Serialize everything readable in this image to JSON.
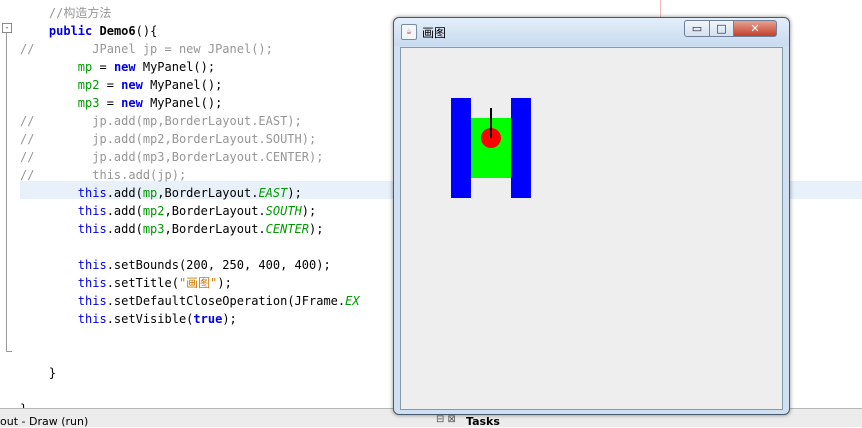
{
  "editor": {
    "lines": [
      {
        "parts": [
          {
            "t": "    ",
            "c": ""
          },
          {
            "t": "//构造方法",
            "c": "cm"
          }
        ]
      },
      {
        "parts": [
          {
            "t": "    ",
            "c": ""
          },
          {
            "t": "public",
            "c": "kwb"
          },
          {
            "t": " ",
            "c": ""
          },
          {
            "t": "Demo6",
            "c": "mth"
          },
          {
            "t": "(){",
            "c": ""
          }
        ]
      },
      {
        "parts": [
          {
            "t": "//        JPanel jp = new JPanel();",
            "c": "cm"
          }
        ]
      },
      {
        "parts": [
          {
            "t": "        ",
            "c": ""
          },
          {
            "t": "mp",
            "c": "fld"
          },
          {
            "t": " = ",
            "c": ""
          },
          {
            "t": "new",
            "c": "kwb"
          },
          {
            "t": " MyPanel();",
            "c": ""
          }
        ]
      },
      {
        "parts": [
          {
            "t": "        ",
            "c": ""
          },
          {
            "t": "mp2",
            "c": "fld"
          },
          {
            "t": " = ",
            "c": ""
          },
          {
            "t": "new",
            "c": "kwb"
          },
          {
            "t": " MyPanel();",
            "c": ""
          }
        ]
      },
      {
        "parts": [
          {
            "t": "        ",
            "c": ""
          },
          {
            "t": "mp3",
            "c": "fld"
          },
          {
            "t": " = ",
            "c": ""
          },
          {
            "t": "new",
            "c": "kwb"
          },
          {
            "t": " MyPanel();",
            "c": ""
          }
        ]
      },
      {
        "parts": [
          {
            "t": "//        jp.add(mp,BorderLayout.EAST);",
            "c": "cm"
          }
        ]
      },
      {
        "parts": [
          {
            "t": "//        jp.add(mp2,BorderLayout.SOUTH);",
            "c": "cm"
          }
        ]
      },
      {
        "parts": [
          {
            "t": "//        jp.add(mp3,BorderLayout.CENTER);",
            "c": "cm"
          }
        ]
      },
      {
        "parts": [
          {
            "t": "//        this.add(jp);",
            "c": "cm"
          }
        ]
      },
      {
        "parts": [
          {
            "t": "        ",
            "c": ""
          },
          {
            "t": "this",
            "c": "kw"
          },
          {
            "t": ".add(",
            "c": ""
          },
          {
            "t": "mp",
            "c": "fld"
          },
          {
            "t": ",BorderLayout.",
            "c": ""
          },
          {
            "t": "EAST",
            "c": "sfld"
          },
          {
            "t": ");",
            "c": ""
          }
        ]
      },
      {
        "parts": [
          {
            "t": "        ",
            "c": ""
          },
          {
            "t": "this",
            "c": "kw"
          },
          {
            "t": ".add(",
            "c": ""
          },
          {
            "t": "mp2",
            "c": "fld"
          },
          {
            "t": ",BorderLayout.",
            "c": ""
          },
          {
            "t": "SOUTH",
            "c": "sfld"
          },
          {
            "t": ");",
            "c": ""
          }
        ]
      },
      {
        "parts": [
          {
            "t": "        ",
            "c": ""
          },
          {
            "t": "this",
            "c": "kw"
          },
          {
            "t": ".add(",
            "c": ""
          },
          {
            "t": "mp3",
            "c": "fld"
          },
          {
            "t": ",BorderLayout.",
            "c": ""
          },
          {
            "t": "CENTER",
            "c": "sfld"
          },
          {
            "t": ");",
            "c": ""
          }
        ]
      },
      {
        "parts": [
          {
            "t": "",
            "c": ""
          }
        ]
      },
      {
        "parts": [
          {
            "t": "        ",
            "c": ""
          },
          {
            "t": "this",
            "c": "kw"
          },
          {
            "t": ".setBounds(200, 250, 400, 400);",
            "c": ""
          }
        ]
      },
      {
        "parts": [
          {
            "t": "        ",
            "c": ""
          },
          {
            "t": "this",
            "c": "kw"
          },
          {
            "t": ".setTitle(",
            "c": ""
          },
          {
            "t": "\"画图\"",
            "c": "str"
          },
          {
            "t": ");",
            "c": ""
          }
        ]
      },
      {
        "parts": [
          {
            "t": "        ",
            "c": ""
          },
          {
            "t": "this",
            "c": "kw"
          },
          {
            "t": ".setDefaultCloseOperation(JFrame.",
            "c": ""
          },
          {
            "t": "EX",
            "c": "sfld"
          }
        ]
      },
      {
        "parts": [
          {
            "t": "        ",
            "c": ""
          },
          {
            "t": "this",
            "c": "kw"
          },
          {
            "t": ".setVisible(",
            "c": ""
          },
          {
            "t": "true",
            "c": "kwb"
          },
          {
            "t": ");",
            "c": ""
          }
        ]
      },
      {
        "parts": [
          {
            "t": "",
            "c": ""
          }
        ]
      },
      {
        "parts": [
          {
            "t": "",
            "c": ""
          }
        ]
      },
      {
        "parts": [
          {
            "t": "    }",
            "c": ""
          }
        ]
      },
      {
        "parts": [
          {
            "t": "",
            "c": ""
          }
        ]
      },
      {
        "parts": [
          {
            "t": "}",
            "c": ""
          }
        ]
      }
    ]
  },
  "statusbar": {
    "left": "out - Draw (run)",
    "icons": "⊟ ⊠",
    "tasks": "Tasks"
  },
  "window": {
    "title": "画图",
    "icon": "java-cup-icon",
    "min_glyph": "▭",
    "max_glyph": "□",
    "close_glyph": "✕"
  },
  "canvas": {
    "colors": {
      "track": "#0000ff",
      "body": "#00ff00",
      "turret": "#ff0000",
      "barrel": "#000000",
      "background": "#eeeeee"
    }
  }
}
